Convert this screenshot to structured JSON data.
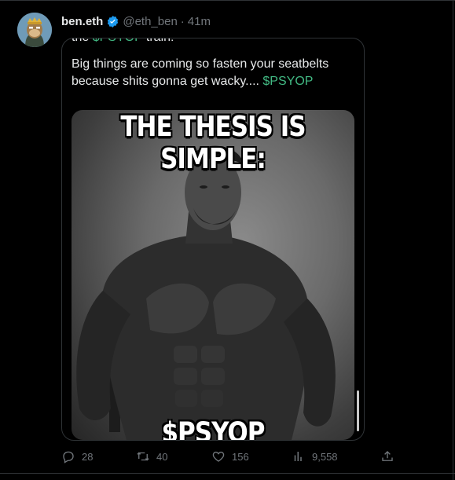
{
  "tweet": {
    "author_name": "ben.eth",
    "handle": "@eth_ben",
    "separator": "·",
    "time": "41m"
  },
  "quote": {
    "line1_prefix": "the",
    "line1_cashtag": "$PSYOP",
    "line1_suffix": "train!",
    "line2": "Big things are coming so fasten your seatbelts",
    "line3_text": "because shits gonna get wacky....",
    "line3_cashtag": "$PSYOP",
    "meme_top_text": "THE THESIS IS SIMPLE:",
    "meme_bottom_text": "$PSYOP"
  },
  "actions": {
    "replies": "28",
    "retweets": "40",
    "likes": "156",
    "views": "9,558"
  },
  "colors": {
    "background": "#000000",
    "accent_green": "#42b983",
    "verified_blue": "#1d9bf0",
    "muted": "#71767b"
  }
}
